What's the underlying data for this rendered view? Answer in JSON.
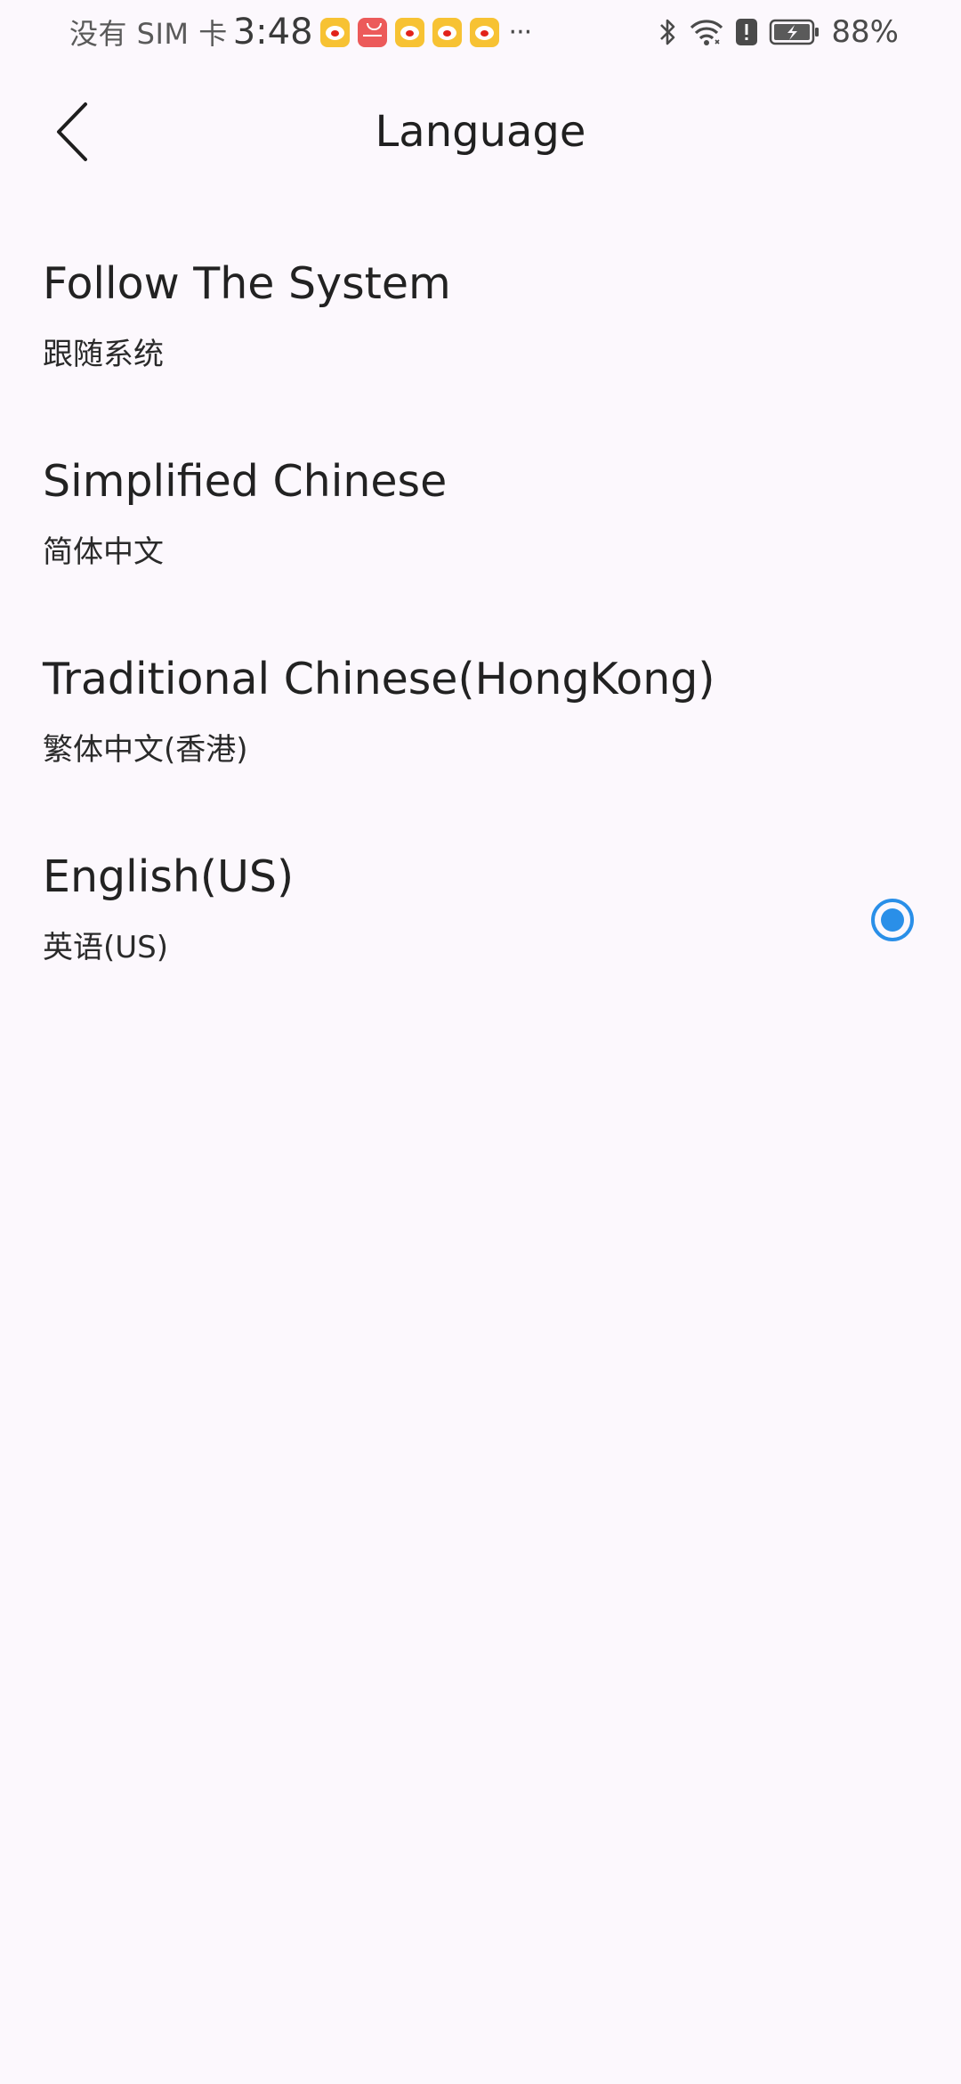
{
  "status_bar": {
    "carrier": "没有 SIM 卡",
    "time": "3:48",
    "more": "···",
    "battery_percent": "88%",
    "notification_icons": [
      "weibo-icon",
      "huawei-store-icon",
      "weibo-icon",
      "weibo-icon",
      "weibo-icon"
    ],
    "system_icons": [
      "bluetooth-icon",
      "wifi-icon",
      "alert-icon",
      "battery-charging-icon"
    ]
  },
  "header": {
    "title": "Language",
    "back_icon": "chevron-left-icon"
  },
  "languages": [
    {
      "name": "Follow The System",
      "native": "跟随系统",
      "selected": false
    },
    {
      "name": "Simplified Chinese",
      "native": "简体中文",
      "selected": false
    },
    {
      "name": "Traditional Chinese(HongKong)",
      "native": "繁体中文(香港)",
      "selected": false
    },
    {
      "name": "English(US)",
      "native": "英语(US)",
      "selected": true
    }
  ],
  "colors": {
    "background": "#fcf8fd",
    "accent": "#2a8fe8",
    "text": "#222222"
  }
}
